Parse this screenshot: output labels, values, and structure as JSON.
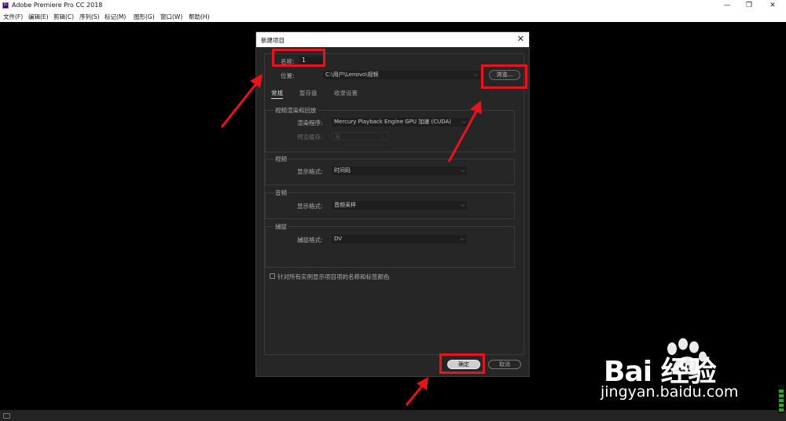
{
  "titlebar": {
    "app_icon": "Pr",
    "title": "Adobe Premiere Pro CC 2018",
    "minimize": "—",
    "restore": "❐",
    "close": "✕"
  },
  "menu": [
    "文件(F)",
    "编辑(E)",
    "剪辑(C)",
    "序列(S)",
    "标记(M)",
    "图形(G)",
    "窗口(W)",
    "帮助(H)"
  ],
  "dialog": {
    "title": "新建项目",
    "close": "✕",
    "name_label": "名称:",
    "name_value": "1",
    "location_label": "位置:",
    "location_value": "C:\\用户\\Lenovo\\视频",
    "browse": "浏览...",
    "tabs": [
      "常规",
      "暂存盘",
      "收录设置"
    ],
    "video_render": {
      "title": "视频渲染和回放",
      "renderer_label": "渲染程序:",
      "renderer_value": "Mercury Playback Engine GPU 加速 (CUDA)",
      "preview_cache_label": "预览缓存:",
      "preview_cache_value": "无"
    },
    "video": {
      "title": "视频",
      "display_label": "显示格式:",
      "display_value": "时间码"
    },
    "audio": {
      "title": "音频",
      "display_label": "显示格式:",
      "display_value": "音频采样"
    },
    "capture": {
      "title": "捕捉",
      "format_label": "捕捉格式:",
      "format_value": "DV"
    },
    "checkbox_label": "针对所有实例显示项目项的名称和标签颜色",
    "ok": "确定",
    "cancel": "取消"
  },
  "annotation_color": "#e8141b",
  "watermark": {
    "brand": "Bai  经验",
    "url": "jingyan.baidu.com"
  }
}
